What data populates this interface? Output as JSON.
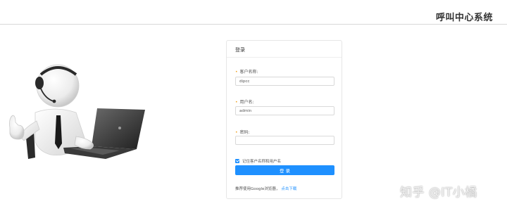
{
  "header": {
    "app_title": "呼叫中心系统"
  },
  "illustration": {
    "icon": "customer-service-agent-laptop"
  },
  "login": {
    "title": "登录",
    "tenant": {
      "label": "客户名称:",
      "value": "dipcc",
      "required": true
    },
    "username": {
      "label": "用户名:",
      "value": "admin",
      "required": true
    },
    "password": {
      "label": "密码:",
      "value": "",
      "required": true
    },
    "remember": {
      "label": "记住客户名称和用户名",
      "checked": true
    },
    "submit_label": "登 录",
    "tip_text": "推荐使用Google浏览器，",
    "tip_link": "点击下载"
  },
  "watermark": {
    "text": "知乎 @IT小橘"
  },
  "colors": {
    "accent": "#1e90ff",
    "required_mark": "#f0a020",
    "border": "#d9d9d9"
  }
}
